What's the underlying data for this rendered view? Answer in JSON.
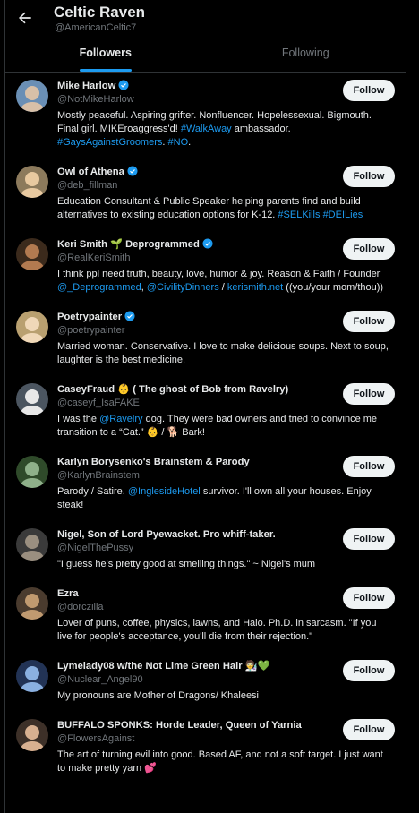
{
  "header": {
    "title": "Celtic Raven",
    "handle": "@AmericanCeltic7"
  },
  "tabs": [
    "Followers",
    "Following"
  ],
  "follow_label": "Follow",
  "colors": {
    "accent": "#1d9bf0",
    "background": "#000000",
    "muted": "#71767b"
  },
  "users": [
    {
      "name": "Mike Harlow",
      "handle": "@NotMikeHarlow",
      "verified": true,
      "bio": [
        {
          "t": "Mostly peaceful. Aspiring grifter. Nonfluencer. Hopelessexual. Bigmouth. Final girl. MIKEroaggress'd! "
        },
        {
          "t": "#WalkAway",
          "l": 1
        },
        {
          "t": " ambassador. "
        },
        {
          "t": "#GaysAgainstGroomers",
          "l": 1
        },
        {
          "t": ". "
        },
        {
          "t": "#NO",
          "l": 1
        },
        {
          "t": "."
        }
      ]
    },
    {
      "name": "Owl of Athena",
      "handle": "@deb_fillman",
      "verified": true,
      "bio": [
        {
          "t": "Education Consultant & Public Speaker helping parents find and build alternatives to existing education options for K-12. "
        },
        {
          "t": "#SELKills",
          "l": 1
        },
        {
          "t": " "
        },
        {
          "t": "#DEILies",
          "l": 1
        }
      ]
    },
    {
      "name": "Keri Smith 🌱 Deprogrammed",
      "handle": "@RealKeriSmith",
      "verified": true,
      "bio": [
        {
          "t": "I think ppl need truth, beauty, love, humor & joy. Reason & Faith / Founder "
        },
        {
          "t": "@_Deprogrammed",
          "l": 1
        },
        {
          "t": ", "
        },
        {
          "t": "@CivilityDinners",
          "l": 1
        },
        {
          "t": " / "
        },
        {
          "t": "kerismith.net",
          "l": 1
        },
        {
          "t": " ((you/your mom/thou))"
        }
      ]
    },
    {
      "name": "Poetrypainter",
      "handle": "@poetrypainter",
      "verified": true,
      "bio": [
        {
          "t": "Married woman. Conservative. I love to make delicious soups. Next to soup, laughter is the best medicine."
        }
      ]
    },
    {
      "name": "CaseyFraud 👶 ( The ghost of Bob from Ravelry)",
      "handle": "@caseyf_IsaFAKE",
      "verified": false,
      "bio": [
        {
          "t": "I was the "
        },
        {
          "t": "@Ravelry",
          "l": 1
        },
        {
          "t": " dog. They were bad owners and tried to convince me transition to a “Cat.” 👶 / 🐕 Bark!"
        }
      ]
    },
    {
      "name": "Karlyn Borysenko's Brainstem & Parody",
      "handle": "@KarlynBrainstem",
      "verified": false,
      "bio": [
        {
          "t": "Parody / Satire. "
        },
        {
          "t": "@InglesideHotel",
          "l": 1
        },
        {
          "t": " survivor. I'll own all your houses. Enjoy steak!"
        }
      ]
    },
    {
      "name": "Nigel, Son of Lord Pyewacket. Pro whiff-taker.",
      "handle": "@NigelThePussy",
      "verified": false,
      "bio": [
        {
          "t": "\"I guess he's pretty good at smelling things.\" ~ Nigel's mum"
        }
      ]
    },
    {
      "name": "Ezra",
      "handle": "@dorczilla",
      "verified": false,
      "bio": [
        {
          "t": "Lover of puns, coffee, physics, lawns, and Halo. Ph.D. in sarcasm. \"If you live for people's acceptance, you'll die from their rejection.\""
        }
      ]
    },
    {
      "name": "Lymelady08 w/the Not Lime Green Hair 🧑‍🔬💚",
      "handle": "@Nuclear_Angel90",
      "verified": false,
      "bio": [
        {
          "t": "My pronouns are Mother of Dragons/ Khaleesi"
        }
      ]
    },
    {
      "name": "BUFFALO SPONKS: Horde Leader, Queen of Yarnia",
      "handle": "@FlowersAgainst",
      "verified": false,
      "bio": [
        {
          "t": "The art of turning evil into good. Based AF, and not a soft target. I just want to make pretty yarn 💕"
        }
      ]
    }
  ]
}
